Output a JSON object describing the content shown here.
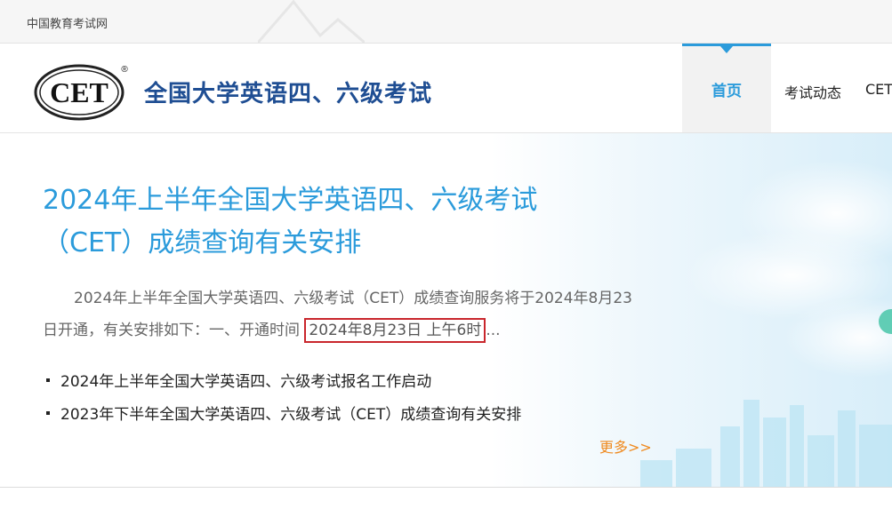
{
  "topbar": {
    "site_link": "中国教育考试网"
  },
  "header": {
    "logo_text": "CET",
    "logo_mark": "®",
    "site_title": "全国大学英语四、六级考试",
    "nav": [
      {
        "label": "首页",
        "active": true
      },
      {
        "label": "考试动态"
      },
      {
        "label": "CET"
      }
    ]
  },
  "banner": {
    "headline": "2024年上半年全国大学英语四、六级考试（CET）成绩查询有关安排",
    "summary_before": "2024年上半年全国大学英语四、六级考试（CET）成绩查询服务将于2024年8月23日开通，有关安排如下：一、开通时间",
    "summary_highlight": "2024年8月23日 上午6时",
    "summary_after": "...",
    "news": [
      "2024年上半年全国大学英语四、六级考试报名工作启动",
      "2023年下半年全国大学英语四、六级考试（CET）成绩查询有关安排"
    ],
    "more": "更多>>"
  },
  "colors": {
    "accent": "#2b9bdb",
    "title_blue": "#1f4e93",
    "more_orange": "#ef8a1f",
    "highlight_red": "#c9262c"
  }
}
